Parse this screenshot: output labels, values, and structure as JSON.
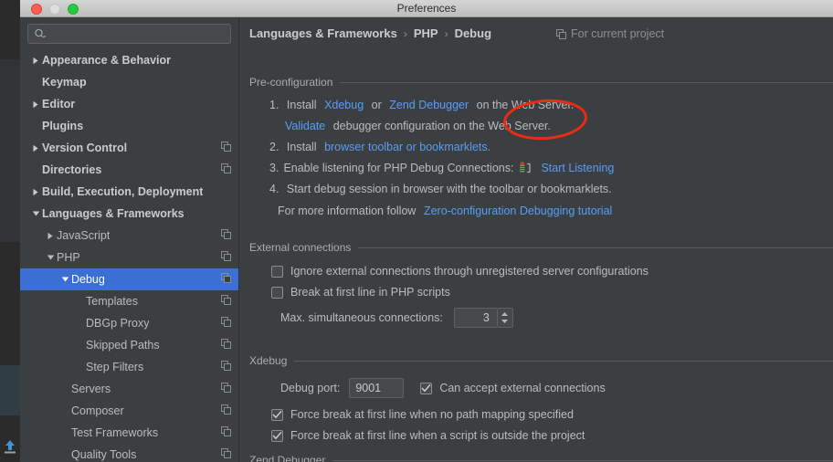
{
  "window": {
    "title": "Preferences",
    "controls": {
      "close": "close-button",
      "minimize": "minimize-button",
      "maximize": "maximize-button"
    }
  },
  "colors": {
    "background": "#3c3f41",
    "selection": "#3b6fd4",
    "link": "#589df6",
    "annotation": "#ee2a11",
    "text": "#b9bdc0"
  },
  "sidebar": {
    "search": {
      "value": "",
      "placeholder": ""
    },
    "items": [
      {
        "label": "Appearance & Behavior",
        "indent": 0,
        "arrow": "collapsed",
        "bold": true,
        "copy": false,
        "selected": false
      },
      {
        "label": "Keymap",
        "indent": 0,
        "arrow": "none",
        "bold": true,
        "copy": false,
        "selected": false
      },
      {
        "label": "Editor",
        "indent": 0,
        "arrow": "collapsed",
        "bold": true,
        "copy": false,
        "selected": false
      },
      {
        "label": "Plugins",
        "indent": 0,
        "arrow": "none",
        "bold": true,
        "copy": false,
        "selected": false
      },
      {
        "label": "Version Control",
        "indent": 0,
        "arrow": "collapsed",
        "bold": true,
        "copy": true,
        "selected": false
      },
      {
        "label": "Directories",
        "indent": 0,
        "arrow": "none",
        "bold": true,
        "copy": true,
        "selected": false
      },
      {
        "label": "Build, Execution, Deployment",
        "indent": 0,
        "arrow": "collapsed",
        "bold": true,
        "copy": false,
        "selected": false
      },
      {
        "label": "Languages & Frameworks",
        "indent": 0,
        "arrow": "expanded",
        "bold": true,
        "copy": false,
        "selected": false
      },
      {
        "label": "JavaScript",
        "indent": 1,
        "arrow": "collapsed",
        "bold": false,
        "copy": true,
        "selected": false
      },
      {
        "label": "PHP",
        "indent": 1,
        "arrow": "expanded",
        "bold": false,
        "copy": true,
        "selected": false
      },
      {
        "label": "Debug",
        "indent": 2,
        "arrow": "expanded",
        "bold": false,
        "copy": true,
        "selected": true
      },
      {
        "label": "Templates",
        "indent": 3,
        "arrow": "none",
        "bold": false,
        "copy": true,
        "selected": false
      },
      {
        "label": "DBGp Proxy",
        "indent": 3,
        "arrow": "none",
        "bold": false,
        "copy": true,
        "selected": false
      },
      {
        "label": "Skipped Paths",
        "indent": 3,
        "arrow": "none",
        "bold": false,
        "copy": true,
        "selected": false
      },
      {
        "label": "Step Filters",
        "indent": 3,
        "arrow": "none",
        "bold": false,
        "copy": true,
        "selected": false
      },
      {
        "label": "Servers",
        "indent": 2,
        "arrow": "none",
        "bold": false,
        "copy": true,
        "selected": false
      },
      {
        "label": "Composer",
        "indent": 2,
        "arrow": "none",
        "bold": false,
        "copy": true,
        "selected": false
      },
      {
        "label": "Test Frameworks",
        "indent": 2,
        "arrow": "none",
        "bold": false,
        "copy": true,
        "selected": false
      },
      {
        "label": "Quality Tools",
        "indent": 2,
        "arrow": "none",
        "bold": false,
        "copy": true,
        "selected": false
      }
    ]
  },
  "content": {
    "breadcrumb": {
      "root": "Languages & Frameworks",
      "mid": "PHP",
      "leaf": "Debug",
      "separator": "›"
    },
    "for_current_project": "For current project",
    "preconfiguration": {
      "title": "Pre-configuration",
      "step1": {
        "num": "1.",
        "install": "Install",
        "xdebug": "Xdebug",
        "or": "or",
        "zend": "Zend Debugger",
        "tail": "on the Web Server."
      },
      "step1b": {
        "validate": "Validate",
        "tail": "debugger configuration on the Web Server."
      },
      "step2": {
        "num": "2.",
        "install": "Install",
        "link": "browser toolbar or bookmarklets."
      },
      "step3": {
        "num": "3.",
        "text": "Enable listening for PHP Debug Connections:",
        "link": "Start Listening"
      },
      "step4": {
        "num": "4.",
        "text": "Start debug session in browser with the toolbar or bookmarklets."
      },
      "more": {
        "text": "For more information follow",
        "link": "Zero-configuration Debugging tutorial"
      }
    },
    "external_connections": {
      "title": "External connections",
      "ignore": {
        "label": "Ignore external connections through unregistered server configurations",
        "checked": false
      },
      "break_first": {
        "label": "Break at first line in PHP scripts",
        "checked": false
      },
      "max_conn": {
        "label": "Max. simultaneous connections:",
        "value": "3"
      }
    },
    "xdebug": {
      "title": "Xdebug",
      "debug_port": {
        "label": "Debug port:",
        "value": "9001"
      },
      "accept_external": {
        "label": "Can accept external connections",
        "checked": true
      },
      "force_no_mapping": {
        "label": "Force break at first line when no path mapping specified",
        "checked": true
      },
      "force_outside": {
        "label": "Force break at first line when a script is outside the project",
        "checked": true
      }
    },
    "zend_debugger": {
      "title": "Zend Debugger"
    }
  }
}
